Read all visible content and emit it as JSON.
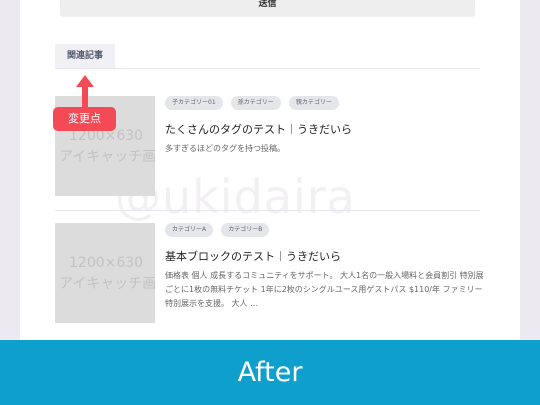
{
  "form": {
    "submit_label": "送信"
  },
  "related": {
    "heading": "関連記事",
    "articles": [
      {
        "thumb_line1": "1200×630",
        "thumb_line2": "アイキャッチ画像",
        "tags": [
          "子カテゴリー01",
          "孫カテゴリー",
          "親カテゴリー"
        ],
        "title": "たくさんのタグのテスト",
        "author": "うきだいら",
        "desc": "多すぎるほどのタグを持つ投稿。"
      },
      {
        "thumb_line1": "1200×630",
        "thumb_line2": "アイキャッチ画像",
        "tags": [
          "カテゴリーA",
          "カテゴリーB"
        ],
        "title": "基本ブロックのテスト",
        "author": "うきだいら",
        "desc": "価格表 個人 成長するコミュニティをサポート。 大人1名の一般入場料と会員割引 特別展ごとに1枚の無料チケット 1年に2枚のシングルユース用ゲストパス $110/年 ファミリー 特別展示を支援。 大人 …"
      }
    ]
  },
  "watermark": "@ukidaira",
  "annotation": {
    "label": "変更点",
    "color": "#f44a55"
  },
  "banner": {
    "label": "After",
    "color": "#0f9fcc"
  }
}
